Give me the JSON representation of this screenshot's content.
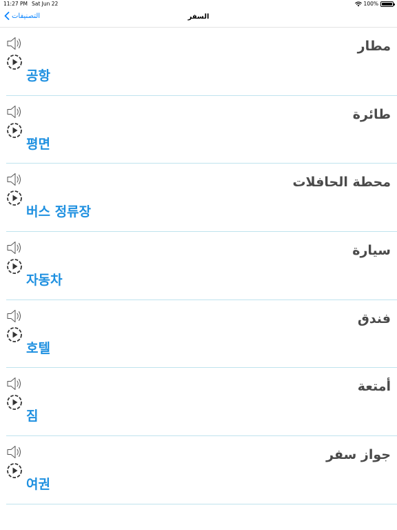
{
  "status_bar": {
    "time": "11:27 PM",
    "date": "Sat Jun 22",
    "battery": "100%",
    "battery_level": 1.0
  },
  "nav": {
    "back_label": "التصنيفات",
    "title": "السفر"
  },
  "items": [
    {
      "arabic": "مطار",
      "korean": "공항"
    },
    {
      "arabic": "طائرة",
      "korean": "평면"
    },
    {
      "arabic": "محطة الحافلات",
      "korean": "버스 정류장"
    },
    {
      "arabic": "سيارة",
      "korean": "자동차"
    },
    {
      "arabic": "فندق",
      "korean": "호텔"
    },
    {
      "arabic": "أمتعة",
      "korean": "짐"
    },
    {
      "arabic": "جواز سفر",
      "korean": "여권"
    }
  ],
  "colors": {
    "accent": "#0a84ff",
    "korean_text": "#1e90e0",
    "arabic_text": "#4a4a4a",
    "divider": "#bfe3ee"
  },
  "icons": {
    "audio": "speaker-icon",
    "play": "play-circle-icon",
    "back": "chevron-left-icon"
  }
}
